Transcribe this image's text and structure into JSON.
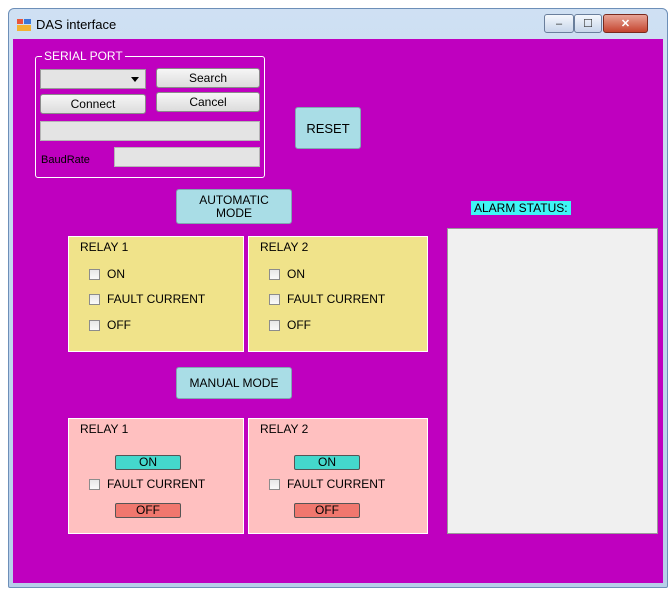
{
  "window": {
    "title": "DAS interface",
    "controls": {
      "minimize": "–",
      "maximize": "☐",
      "close": "✕"
    }
  },
  "serial_port": {
    "legend": "SERIAL PORT",
    "port_combo_value": "",
    "search_label": "Search",
    "connect_label": "Connect",
    "cancel_label": "Cancel",
    "status_value": "",
    "baud_label": "BaudRate",
    "baud_value": ""
  },
  "reset_label": "RESET",
  "automatic_mode": {
    "button_label": "AUTOMATIC MODE",
    "relays": [
      {
        "title": "RELAY 1",
        "on": "ON",
        "fault": "FAULT CURRENT",
        "off": "OFF"
      },
      {
        "title": "RELAY 2",
        "on": "ON",
        "fault": "FAULT CURRENT",
        "off": "OFF"
      }
    ]
  },
  "manual_mode": {
    "button_label": "MANUAL MODE",
    "relays": [
      {
        "title": "RELAY 1",
        "on": "ON",
        "fault": "FAULT CURRENT",
        "off": "OFF"
      },
      {
        "title": "RELAY 2",
        "on": "ON",
        "fault": "FAULT CURRENT",
        "off": "OFF"
      }
    ]
  },
  "alarm": {
    "label": "ALARM STATUS:",
    "content": ""
  },
  "colors": {
    "background": "#bf00bf",
    "auto_panel": "#f0e38a",
    "manual_panel": "#ffc0c0",
    "on_button": "#44d8cc",
    "off_button": "#f0776e",
    "mode_button": "#a9dde6",
    "alarm_label": "#3ff5f5"
  }
}
